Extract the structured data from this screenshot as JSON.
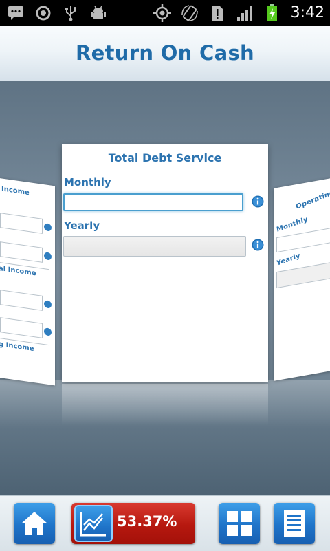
{
  "status_bar": {
    "time": "3:42",
    "icons_left": [
      "message-icon",
      "record-icon",
      "usb-icon",
      "android-debug-icon"
    ],
    "icons_right": [
      "gps-icon",
      "rotate-icon",
      "sim-alert-icon",
      "signal-icon",
      "battery-charging-icon"
    ]
  },
  "header": {
    "title": "Return On Cash"
  },
  "card": {
    "title": "Total Debt Service",
    "monthly": {
      "label": "Monthly",
      "value": "",
      "placeholder": ""
    },
    "yearly": {
      "label": "Yearly",
      "value": "",
      "placeholder": ""
    }
  },
  "side_left": {
    "labels": [
      "Income",
      "al Income",
      "g Income",
      "g Income"
    ]
  },
  "side_right": {
    "title": "Operating",
    "labels": [
      "Monthly",
      "Yearly"
    ]
  },
  "toolbar": {
    "ratio_value": "53.37%"
  },
  "colors": {
    "accent": "#2d74b0",
    "ratio_red": "#c21f16",
    "button_blue": "#1f74c9"
  }
}
